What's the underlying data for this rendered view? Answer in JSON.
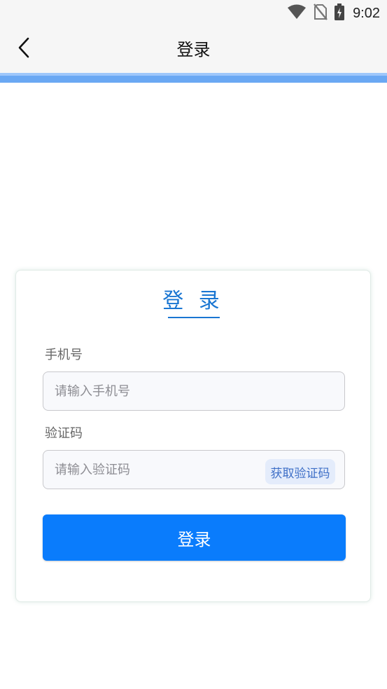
{
  "status_bar": {
    "time": "9:02",
    "icons": [
      "wifi-icon",
      "no-sim-icon",
      "battery-charging-icon"
    ]
  },
  "header": {
    "back_icon": "chevron-left-icon",
    "title": "登录"
  },
  "card": {
    "title": "登 录",
    "phone": {
      "label": "手机号",
      "placeholder": "请输入手机号",
      "value": ""
    },
    "code": {
      "label": "验证码",
      "placeholder": "请输入验证码",
      "value": "",
      "get_code_label": "获取验证码"
    },
    "submit_label": "登录"
  },
  "colors": {
    "accent": "#1a76d2",
    "primary_button": "#0a7cfc",
    "header_bar": "#6aa8f3",
    "code_button_bg": "#e4ecfb"
  }
}
